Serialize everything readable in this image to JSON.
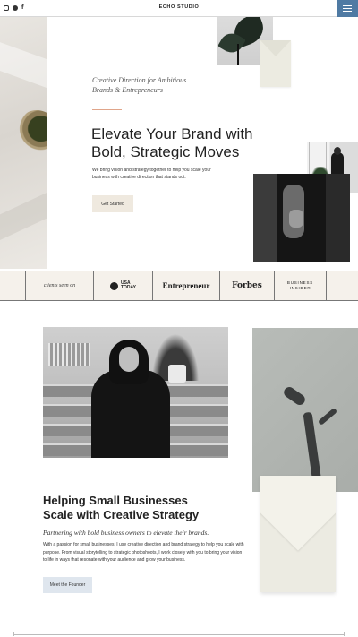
{
  "header": {
    "brand": "ECHO STUDIO",
    "social_icons": [
      "instagram-icon",
      "pinterest-icon",
      "facebook-icon"
    ],
    "facebook_glyph": "f",
    "menu_icon": "hamburger-icon",
    "menu_color": "#4f7aa3"
  },
  "hero": {
    "tagline_line1": "Creative Direction for Ambitious",
    "tagline_line2": "Brands & Entrepreneurs",
    "title_line1": "Elevate Your Brand with",
    "title_line2": "Bold, Strategic Moves",
    "body": "We bring vision and strategy together to help you scale your business with creative direction that stands out.",
    "cta_label": "Get Started",
    "accent_color": "#e0a58a"
  },
  "logos": {
    "seen_on": "clients seen on",
    "usa_today_line1": "USA",
    "usa_today_line2": "TODAY",
    "entrepreneur": "Entrepreneur",
    "forbes": "Forbes",
    "business_insider_line1": "BUSINESS",
    "business_insider_line2": "INSIDER"
  },
  "about": {
    "title_line1": "Helping Small Businesses",
    "title_line2": "Scale with Creative Strategy",
    "subtitle": "Partnering with bold business owners to elevate their brands.",
    "body": "With a passion for small businesses, I use creative direction and brand strategy to help you scale with purpose. From visual storytelling to strategic photoshoots, I work closely with you to bring your vision to life in ways that resonate with your audience and grow your business.",
    "button_label": "Meet the Founder"
  }
}
